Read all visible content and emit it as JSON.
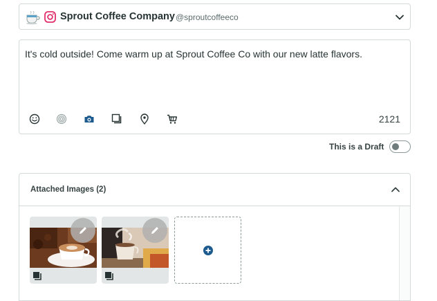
{
  "profile": {
    "avatar_icon": "coffee-cup-avatar",
    "network_icon": "instagram-icon",
    "name": "Sprout Coffee Company",
    "handle": "@sproutcoffeeco",
    "chevron_icon": "chevron-down-icon"
  },
  "composer": {
    "message": "It's cold outside! Come warm up at Sprout Coffee Co with our new latte flavors.",
    "character_count": "2121",
    "toolbar_icons": [
      "smiley-icon",
      "target-icon",
      "camera-icon",
      "gallery-icon",
      "location-pin-icon",
      "cart-icon"
    ]
  },
  "draft": {
    "label": "This is a Draft",
    "enabled": false
  },
  "attached": {
    "title": "Attached Images (2)",
    "images": [
      {
        "name": "latte-art-image",
        "icons": [
          "pencil-icon",
          "stack-icon"
        ]
      },
      {
        "name": "steaming-coffee-image",
        "icons": [
          "pencil-icon",
          "stack-icon"
        ]
      }
    ],
    "add_icon": "plus-circle-icon"
  },
  "colors": {
    "instagram": "#e1306c",
    "accent": "#1d5b8e",
    "border": "#d4d9d9",
    "text": "#364141"
  }
}
